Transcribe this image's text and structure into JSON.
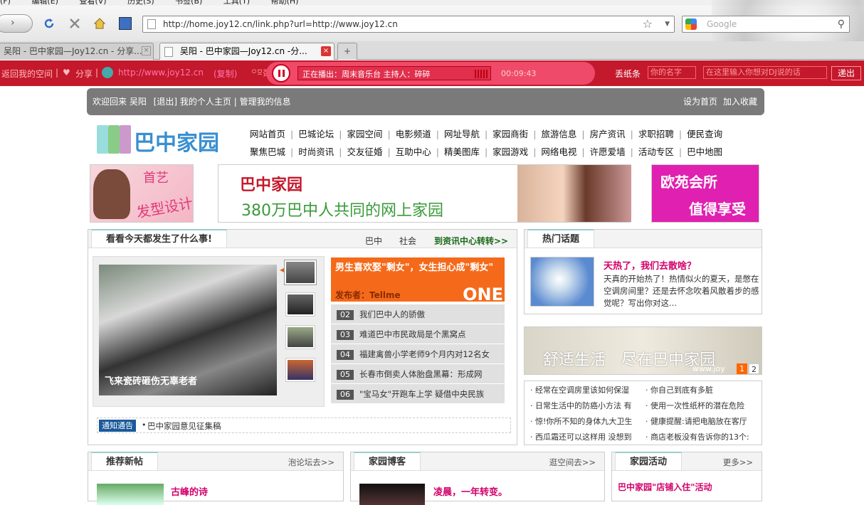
{
  "browser": {
    "menu": [
      "(F)",
      "编辑(E)",
      "查看(V)",
      "历史(S)",
      "书签(B)",
      "工具(T)",
      "帮助(H)"
    ],
    "url": "http://home.joy12.cn/link.php?url=http://www.joy12.cn",
    "search_placeholder": "Google",
    "tabs": [
      {
        "label": "吴阳 - 巴中家园—Joy12.cn - 分享..."
      },
      {
        "label": "吴阳 - 巴中家园—Joy12.cn -分..."
      }
    ],
    "new_tab": "+"
  },
  "toolbar": {
    "back_space": "返回我的空间",
    "share": "分享",
    "site_link": "http://www.joy12.cn",
    "copy": "(复制)",
    "radio_label": "RADIO",
    "now_playing": "正在播出：周末音乐台 主持人：碎碎",
    "time": "00:09:43",
    "note_label": "丢纸条",
    "name_placeholder": "你的名字",
    "msg_placeholder": "在这里输入你想对DJ说的话",
    "send": "递出"
  },
  "welcome": {
    "text": "欢迎回来 吴阳",
    "logout": "[退出]",
    "home": "我的个人主页",
    "manage": "管理我的信息",
    "set_home": "设为首页",
    "favorite": "加入收藏"
  },
  "logo": {
    "text": "巴中家园"
  },
  "nav_row1": [
    "网站首页",
    "巴城论坛",
    "家园空间",
    "电影频道",
    "网址导航",
    "家园商街",
    "旅游信息",
    "房产资讯",
    "求职招聘",
    "便民查询"
  ],
  "nav_row2": [
    "聚焦巴城",
    "时尚资讯",
    "交友征婚",
    "互助中心",
    "精美图库",
    "家园游戏",
    "网络电视",
    "许愿爱墙",
    "活动专区",
    "巴中地图"
  ],
  "ads": {
    "left_line1": "首艺",
    "left_line2": "发型设计",
    "center_brand": "巴中家园",
    "center_slogan": "380万巴中人共同的网上家园",
    "right_line1": "欧苑会所",
    "right_line2": "值得享受"
  },
  "news": {
    "title": "看看今天都发生了什么事!",
    "tab1": "巴中",
    "tab2": "社会",
    "more": "到资讯中心转转>>",
    "photo_caption": "飞来瓷砖砸伤无辜老者",
    "feature_title": "男生喜欢娶\"剩女\"，女生担心成\"剩女\"",
    "feature_author": "发布者：Tellme",
    "feature_one": "ONE",
    "items": [
      {
        "n": "02",
        "t": "我们巴中人的骄傲"
      },
      {
        "n": "03",
        "t": "难道巴中市民政局是个黑窝点"
      },
      {
        "n": "04",
        "t": "福建禽兽小学老师9个月内对12名女"
      },
      {
        "n": "05",
        "t": "长春市倒卖人体胎盘黑幕：形成网"
      },
      {
        "n": "06",
        "t": "\"宝马女\"开跑车上学 疑借中央民族"
      }
    ],
    "notice_label": "通知通告",
    "notice_text": "巴中家园意见征集稿"
  },
  "hot": {
    "title": "热门话题",
    "headline": "天热了，我们去散啥？",
    "desc": "天真的开始热了！热情似火的夏天，是憋在空调房间里？还是去怀念吹着风散着步的感觉呢？写出你对这...",
    "banner1": "舒适生活",
    "banner2": "尽在巴中家园",
    "banner_url": "www.joy",
    "page1": "1",
    "page2": "2",
    "links_left": [
      "经常在空调房里该如何保湿",
      "日常生活中的防癌小方法 有",
      "惊!你所不知的身体九大卫生",
      "西瓜霜还可以这样用 没想到"
    ],
    "links_right": [
      "你自己到底有多脏",
      "使用一次性纸杯的潜在危险",
      "健康提醒:请把电脑放在客厅",
      "商店老板没有告诉你的13个:"
    ]
  },
  "bottom": {
    "posts_title": "推荐新帖",
    "posts_more": "泡论坛去>>",
    "post_headline": "古峰的诗",
    "blog_title": "家园博客",
    "blog_more": "逛空间去>>",
    "blog_headline": "凌晨，一年转变。",
    "act_title": "家园活动",
    "act_more": "更多>>",
    "act_headline": "巴中家园\"店铺入住\"活动"
  }
}
